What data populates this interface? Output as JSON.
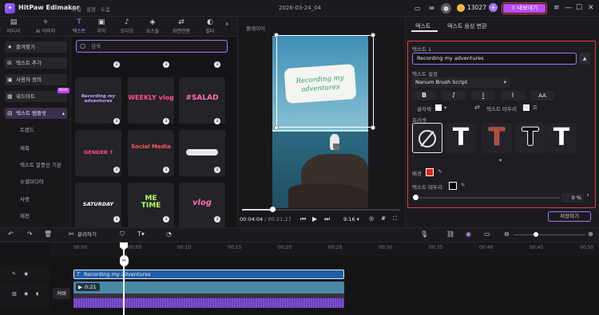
{
  "app": {
    "name": "HitPaw Edimakor",
    "menu": [
      "파일",
      "설정",
      "도움"
    ],
    "project": "2026-03-24_04",
    "coins": "13027",
    "export_label": "내보내기"
  },
  "toolbar": [
    {
      "label": "미디어",
      "icon": "folder-icon"
    },
    {
      "label": "AI 이미지",
      "icon": "ai-icon"
    },
    {
      "label": "텍스트",
      "icon": "text-icon",
      "active": true
    },
    {
      "label": "자막",
      "icon": "subtitle-icon"
    },
    {
      "label": "오디오",
      "icon": "music-icon"
    },
    {
      "label": "요소들",
      "icon": "elements-icon"
    },
    {
      "label": "화면전환",
      "icon": "transition-icon"
    },
    {
      "label": "필터",
      "icon": "filter-icon"
    }
  ],
  "sidebar": {
    "items": [
      {
        "label": "즐겨찾기",
        "icon": "star-icon"
      },
      {
        "label": "텍스트 추가",
        "icon": "add-icon"
      },
      {
        "label": "사용자 정의",
        "icon": "user-icon"
      },
      {
        "label": "워드아트",
        "icon": "wordart-icon",
        "badge": "NEW"
      },
      {
        "label": "텍스트 템플릿",
        "icon": "template-icon",
        "active": true
      }
    ],
    "subitems": [
      "트렌드",
      "제목",
      "텍스트 말풍선 기본",
      "소셜미디어",
      "사랑",
      "제전"
    ]
  },
  "search": {
    "placeholder": "검색"
  },
  "templates": [
    {
      "text": "Recording my adventures",
      "color": "#c9a2ff"
    },
    {
      "text": "WEEKLY vlog",
      "color": "#ff4d8d"
    },
    {
      "text": "#SALAD",
      "color": "#ff6fae"
    },
    {
      "text": "GENDER ?",
      "color": "#ff4d8d"
    },
    {
      "text": "Social Media",
      "color": "#ff5a5a"
    },
    {
      "text": "",
      "color": "#e8e8ee"
    },
    {
      "text": "SATURDAY",
      "color": "#ffffff"
    },
    {
      "text": "ME TIME",
      "color": "#b6ff5c"
    },
    {
      "text": "vlog",
      "color": "#ff6fae"
    }
  ],
  "player": {
    "label": "플레이어",
    "overlay_text": "Recording my adventures",
    "current": "00:04:04",
    "total": "00:21:27",
    "ratio": "9:16",
    "progress": 0.19
  },
  "right": {
    "tabs": [
      "텍스트",
      "텍스트 음성 변환"
    ],
    "text_label": "텍스트 1",
    "text_value": "Recording my adventures",
    "settings_label": "텍스트 설정",
    "font": "Nanum Brush Script",
    "bold": "B",
    "italic": "I",
    "underline": "I",
    "spacing": "I",
    "case": "AA",
    "color_label": "글자색",
    "border_label": "텍스트 테두리",
    "preset_label": "프리셋",
    "background_label": "배경",
    "stroke_label": "텍스트 테두리",
    "opacity_value": "0",
    "opacity_unit": "%",
    "opacity": 0,
    "save_label": "저장하기",
    "bg_color": "#e81c1c",
    "stroke_color": "#000000"
  },
  "timeline": {
    "split_label": "분리하기",
    "ticks": [
      "00:00",
      "00:05",
      "00:10",
      "00:15",
      "00:20",
      "00:25",
      "00:30",
      "00:35",
      "00:40",
      "00:45",
      "00:50"
    ],
    "text_clip": "Recording my adventures",
    "video_clip": "0:21",
    "cover_label": "커버"
  }
}
